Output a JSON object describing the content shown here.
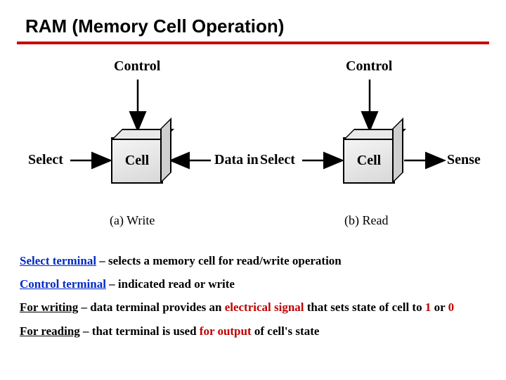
{
  "title": "RAM (Memory Cell Operation)",
  "diagram": {
    "left": {
      "control": "Control",
      "select": "Select",
      "datain": "Data in",
      "cell": "Cell",
      "caption": "(a) Write"
    },
    "right": {
      "control": "Control",
      "select": "Select",
      "sense": "Sense",
      "cell": "Cell",
      "caption": "(b) Read"
    }
  },
  "notes": {
    "l1a": "Select terminal",
    "l1b": " – selects a memory cell for read/write operation",
    "l2a": "Control terminal",
    "l2b": " – indicated read or write",
    "l3a": "For writing",
    "l3b": " – data terminal provides an ",
    "l3c": "electrical signal",
    "l3d": " that sets state of cell to ",
    "l3e": "1",
    "l3f": " or ",
    "l3g": "0",
    "l4a": "For reading",
    "l4b": " – that terminal is used ",
    "l4c": "for output",
    "l4d": " of cell's state"
  }
}
